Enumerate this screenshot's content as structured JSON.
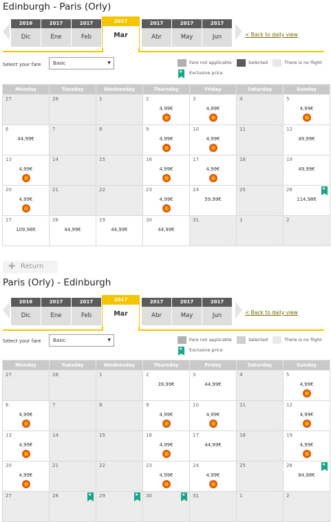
{
  "outbound": {
    "route_title": "Edinburgh - Paris (Orly)",
    "months": [
      {
        "year": "2016",
        "month": "Dic",
        "selected": false
      },
      {
        "year": "2017",
        "month": "Ene",
        "selected": false
      },
      {
        "year": "2017",
        "month": "Feb",
        "selected": false
      },
      {
        "year": "2017",
        "month": "Mar",
        "selected": true
      },
      {
        "year": "2017",
        "month": "Abr",
        "selected": false
      },
      {
        "year": "2017",
        "month": "May",
        "selected": false
      },
      {
        "year": "2017",
        "month": "Jun",
        "selected": false
      }
    ],
    "back_link": "< Back to daily view",
    "fare_label": "Select your fare",
    "fare_value": "Basic",
    "legend": {
      "na": "Fare not applicable",
      "selected": "Selected",
      "noflight": "There is no flight",
      "exclusive": "Exclusive price"
    },
    "weekdays": [
      "Monday",
      "Tuesday",
      "Wednesday",
      "Thursday",
      "Friday",
      "Saturday",
      "Sunday"
    ],
    "weeks": [
      [
        {
          "d": "27"
        },
        {
          "d": "28"
        },
        {
          "d": "1"
        },
        {
          "d": "2",
          "p": "4,99€",
          "o": true
        },
        {
          "d": "3",
          "p": "4,99€",
          "o": true
        },
        {
          "d": "4"
        },
        {
          "d": "5",
          "p": "4,99€",
          "o": true
        }
      ],
      [
        {
          "d": "6",
          "p": "44,99€"
        },
        {
          "d": "7"
        },
        {
          "d": "8"
        },
        {
          "d": "9",
          "p": "4,99€",
          "o": true
        },
        {
          "d": "10",
          "p": "4,99€",
          "o": true
        },
        {
          "d": "11"
        },
        {
          "d": "12",
          "p": "49,99€"
        }
      ],
      [
        {
          "d": "13",
          "p": "4,99€",
          "o": true
        },
        {
          "d": "14"
        },
        {
          "d": "15"
        },
        {
          "d": "16",
          "p": "4,99€",
          "o": true
        },
        {
          "d": "17",
          "p": "4,99€",
          "o": true
        },
        {
          "d": "18"
        },
        {
          "d": "19",
          "p": "49,99€"
        }
      ],
      [
        {
          "d": "20",
          "p": "4,99€",
          "o": true
        },
        {
          "d": "21"
        },
        {
          "d": "22"
        },
        {
          "d": "23",
          "p": "4,99€",
          "o": true
        },
        {
          "d": "24",
          "p": "59,99€"
        },
        {
          "d": "25"
        },
        {
          "d": "26",
          "p": "114,98€",
          "x": true
        }
      ],
      [
        {
          "d": "27",
          "p": "109,98€"
        },
        {
          "d": "28",
          "p": "44,99€"
        },
        {
          "d": "29",
          "p": "44,99€"
        },
        {
          "d": "30",
          "p": "44,99€"
        },
        {
          "d": "31"
        },
        {
          "d": "1"
        },
        {
          "d": "2"
        }
      ]
    ]
  },
  "return_label": "Return",
  "inbound": {
    "route_title": "Paris (Orly) - Edinburgh",
    "months": [
      {
        "year": "2016",
        "month": "Dic",
        "selected": false
      },
      {
        "year": "2017",
        "month": "Ene",
        "selected": false
      },
      {
        "year": "2017",
        "month": "Feb",
        "selected": false
      },
      {
        "year": "2017",
        "month": "Mar",
        "selected": true
      },
      {
        "year": "2017",
        "month": "Abr",
        "selected": false
      },
      {
        "year": "2017",
        "month": "May",
        "selected": false
      },
      {
        "year": "2017",
        "month": "Jun",
        "selected": false
      }
    ],
    "back_link": "< Back to daily view",
    "fare_label": "Select your fare",
    "fare_value": "Basic",
    "legend": {
      "na": "Fare not applicable",
      "selected": "Selected",
      "noflight": "There is no flight",
      "exclusive": "Exclusive price"
    },
    "weekdays": [
      "Monday",
      "Tuesday",
      "Wednesday",
      "Thursday",
      "Friday",
      "Saturday",
      "Sunday"
    ],
    "weeks": [
      [
        {
          "d": "27"
        },
        {
          "d": "28"
        },
        {
          "d": "1"
        },
        {
          "d": "2",
          "p": "39,99€"
        },
        {
          "d": "3",
          "p": "44,99€"
        },
        {
          "d": "4"
        },
        {
          "d": "5",
          "p": "4,99€",
          "o": true
        }
      ],
      [
        {
          "d": "6",
          "p": "4,99€",
          "o": true
        },
        {
          "d": "7"
        },
        {
          "d": "8"
        },
        {
          "d": "9",
          "p": "4,99€",
          "o": true
        },
        {
          "d": "10",
          "p": "4,99€",
          "o": true
        },
        {
          "d": "11"
        },
        {
          "d": "12",
          "p": "4,99€",
          "o": true
        }
      ],
      [
        {
          "d": "13",
          "p": "4,99€",
          "o": true
        },
        {
          "d": "14"
        },
        {
          "d": "15"
        },
        {
          "d": "16",
          "p": "4,99€",
          "o": true
        },
        {
          "d": "17",
          "p": "44,99€"
        },
        {
          "d": "18"
        },
        {
          "d": "19",
          "p": "4,99€",
          "o": true
        }
      ],
      [
        {
          "d": "20",
          "p": "4,99€",
          "o": true
        },
        {
          "d": "21"
        },
        {
          "d": "22"
        },
        {
          "d": "23",
          "p": "4,99€",
          "o": true
        },
        {
          "d": "24",
          "p": "4,99€",
          "o": true
        },
        {
          "d": "25"
        },
        {
          "d": "26",
          "p": "84,98€",
          "x": true
        }
      ],
      [
        {
          "d": "27"
        },
        {
          "d": "28",
          "x": true
        },
        {
          "d": "29",
          "x": true
        },
        {
          "d": "30",
          "x": true
        },
        {
          "d": "31"
        },
        {
          "d": "1"
        },
        {
          "d": "2"
        }
      ]
    ]
  }
}
